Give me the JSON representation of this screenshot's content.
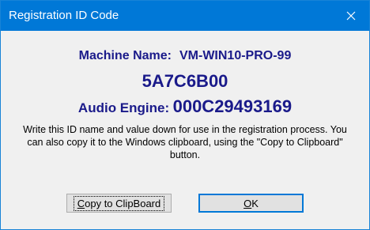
{
  "window": {
    "title": "Registration ID Code",
    "close_icon": "close-icon"
  },
  "machine": {
    "label": "Machine Name:",
    "value": "VM-WIN10-PRO-99"
  },
  "id_code": "5A7C6B00",
  "audio_engine": {
    "label": "Audio Engine:",
    "value": "000C29493169"
  },
  "instructions": "Write this ID name and value down for use in the registration process. You can also copy it to the Windows clipboard, using the \"Copy to Clipboard\" button.",
  "buttons": {
    "copy": {
      "mnemonic": "C",
      "rest": "opy to ClipBoard"
    },
    "ok": {
      "mnemonic": "O",
      "rest": "K"
    }
  },
  "colors": {
    "titlebar": "#0078d7",
    "heading_text": "#1a1a8a",
    "dialog_bg": "#f0f0f0"
  }
}
